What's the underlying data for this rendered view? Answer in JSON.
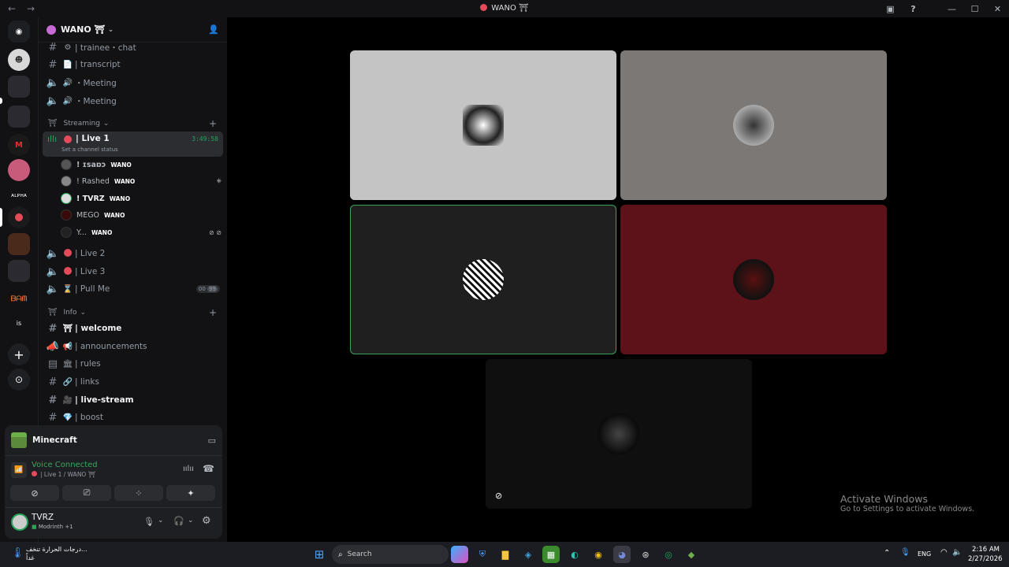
{
  "title_bar": {
    "title": "WANO ⛩"
  },
  "server": {
    "name": "WANO ⛩"
  },
  "channels_top": [
    {
      "emoji": "⚙",
      "label": "| trainee・chat"
    },
    {
      "emoji": "📄",
      "label": "| transcript"
    },
    {
      "emoji": "🔊",
      "label": "・Meeting"
    },
    {
      "emoji": "🔊",
      "label": "・Meeting"
    }
  ],
  "categories": {
    "streaming": "Streaming",
    "info": "Info"
  },
  "live1": {
    "label": "| Live 1",
    "timer": "3:49:58",
    "status": "Set a channel status"
  },
  "voice_users": [
    {
      "name": "! ɪsaɒɔ",
      "tag": "WANO"
    },
    {
      "name": "! Rashed",
      "tag": "WANO"
    },
    {
      "name": "! TVRZ",
      "tag": "WANO"
    },
    {
      "name": "MEGO",
      "tag": "WANO"
    },
    {
      "name": "Y...",
      "tag": "WANO"
    }
  ],
  "voice_channels": [
    {
      "label": "| Live 2"
    },
    {
      "label": "| Live 3"
    },
    {
      "label": "| Pull Me",
      "count_a": "00",
      "count_b": "99"
    }
  ],
  "info_channels": [
    {
      "emoji": "⛩",
      "label": "| welcome",
      "bold": true
    },
    {
      "emoji": "📢",
      "label": "| announcements"
    },
    {
      "emoji": "🏛",
      "label": "| rules"
    },
    {
      "emoji": "🔗",
      "label": "| links"
    },
    {
      "emoji": "🎥",
      "label": "| live-stream",
      "bold": true
    },
    {
      "emoji": "💎",
      "label": "| boost"
    }
  ],
  "activity": {
    "game": "Minecraft"
  },
  "voice": {
    "status": "Voice Connected",
    "location": "| Live 1 / WANO ⛩"
  },
  "user": {
    "name": "TVRZ",
    "sub": "Modrinth +1"
  },
  "watermark": {
    "title": "Activate Windows",
    "sub": "Go to Settings to activate Windows."
  },
  "taskbar": {
    "search_placeholder": "Search",
    "weather_line1": "درجات الحرارة تنخف...",
    "weather_line2": "غداً",
    "lang": "ENG",
    "time": "2:16 AM",
    "date": "2/27/2026"
  },
  "colors": {
    "accent_green": "#23a55a",
    "voice_green": "#3ba55d",
    "tile_red": "#5c1218",
    "tile_gray": "#c4c4c4"
  }
}
